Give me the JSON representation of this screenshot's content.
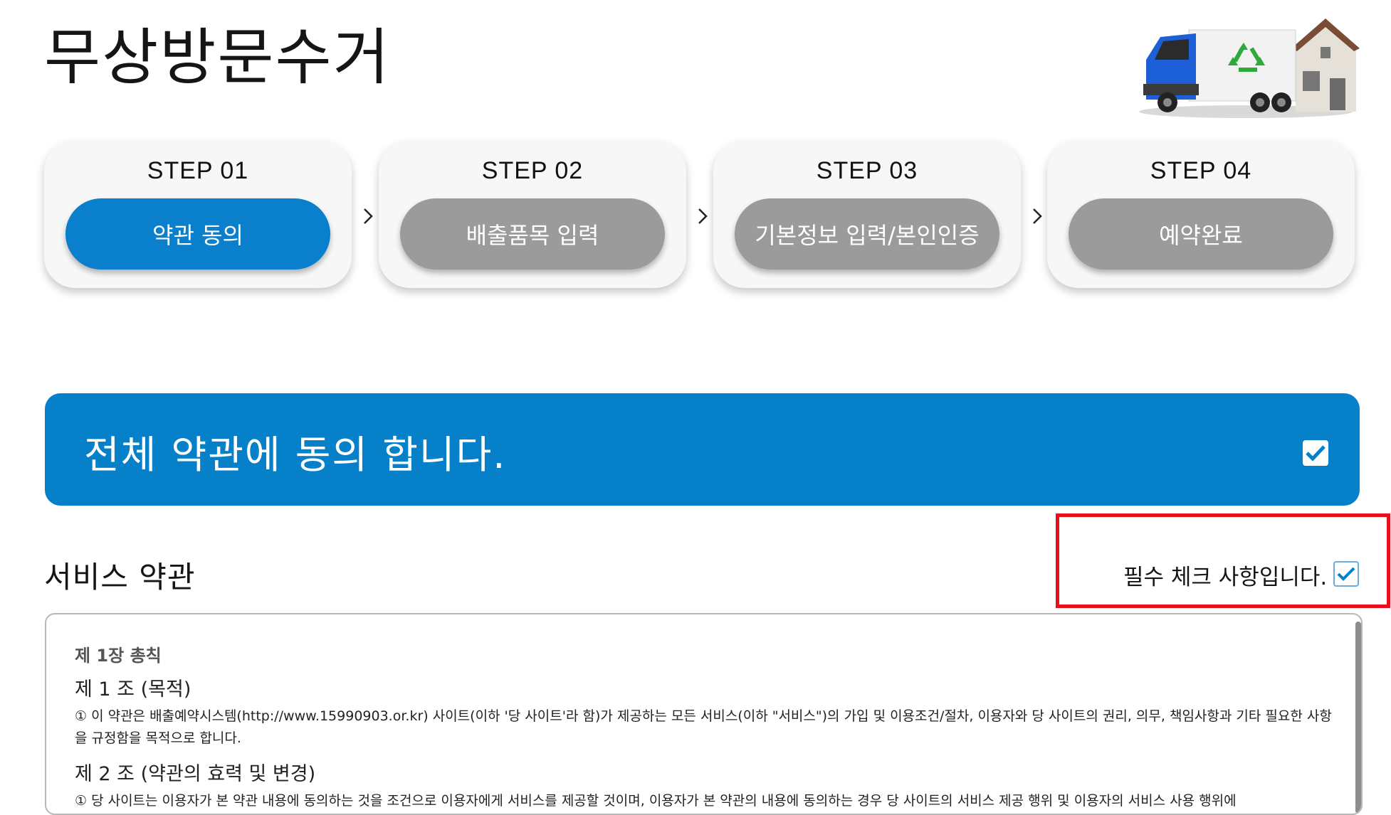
{
  "header": {
    "title": "무상방문수거"
  },
  "steps": [
    {
      "step": "STEP 01",
      "label": "약관 동의",
      "active": true
    },
    {
      "step": "STEP 02",
      "label": "배출품목 입력",
      "active": false
    },
    {
      "step": "STEP 03",
      "label": "기본정보 입력/본인인증",
      "active": false
    },
    {
      "step": "STEP 04",
      "label": "예약완료",
      "active": false
    }
  ],
  "agree_all": {
    "text": "전체 약관에 동의 합니다.",
    "checked": true
  },
  "service_terms": {
    "title": "서비스 약관",
    "required_text": "필수 체크 사항입니다.",
    "required_checked": true,
    "chapter": "제 1장 총칙",
    "article1_title": "제 1 조 (목적)",
    "article1_text": "① 이 약관은 배출예약시스템(http://www.15990903.or.kr) 사이트(이하 '당 사이트'라 함)가 제공하는 모든 서비스(이하 \"서비스\")의 가입 및 이용조건/절차, 이용자와 당 사이트의 권리, 의무, 책임사항과 기타 필요한 사항을 규정함을 목적으로 합니다.",
    "article2_title": "제 2 조 (약관의 효력 및 변경)",
    "article2_text": "① 당 사이트는 이용자가 본 약관 내용에 동의하는 것을 조건으로 이용자에게 서비스를 제공할 것이며, 이용자가 본 약관의 내용에 동의하는 경우 당 사이트의 서비스 제공 행위 및 이용자의 서비스 사용 행위에"
  },
  "colors": {
    "accent": "#0780ca",
    "inactive_pill": "#9b9b9b",
    "highlight": "#e8101a"
  },
  "icons": {
    "hero": "recycling-truck-house-illustration",
    "arrow": "chevron-right-icon",
    "check": "checkmark-icon"
  }
}
